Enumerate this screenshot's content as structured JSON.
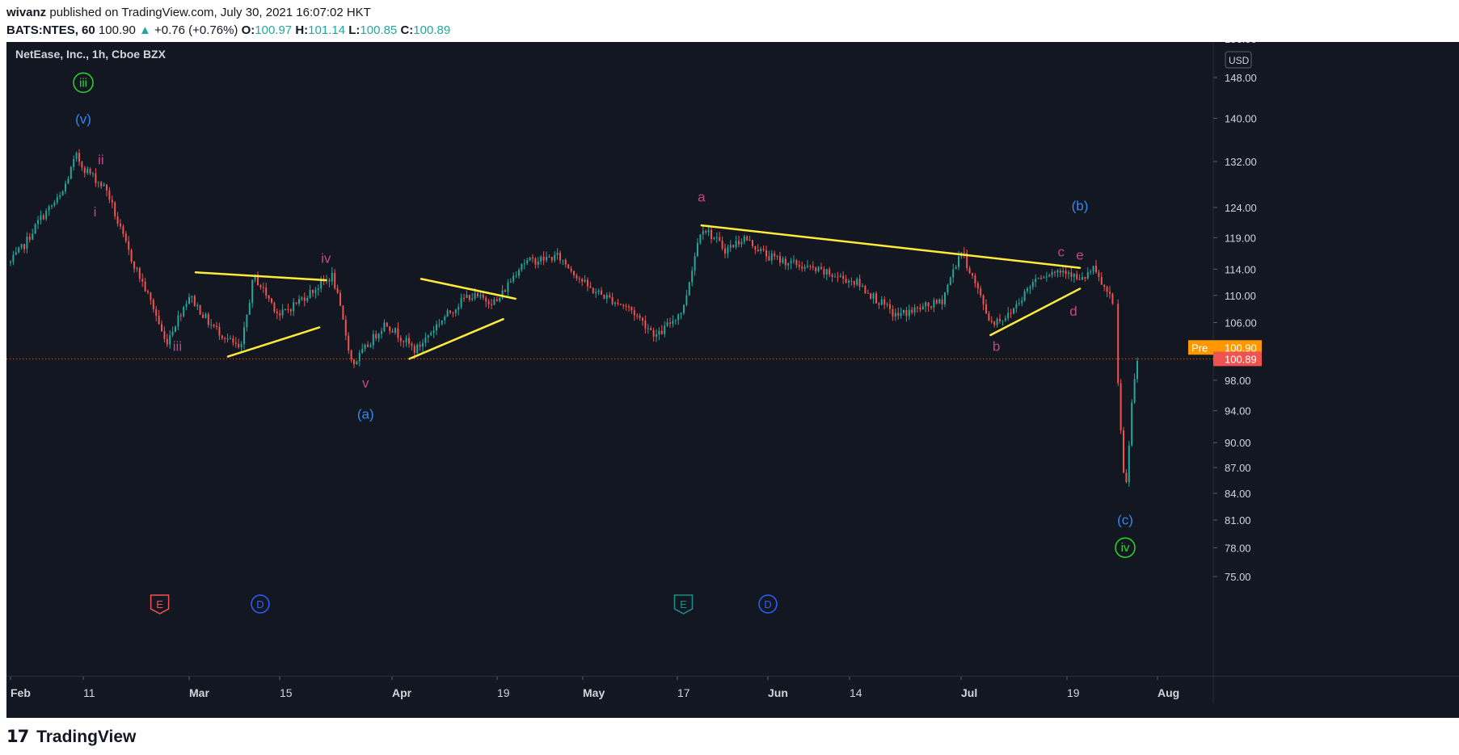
{
  "header": {
    "publisher": "wivanz",
    "published_text": "published on TradingView.com, July 30, 2021 16:07:02 HKT",
    "symbol": "BATS:NTES, 60",
    "last": "100.90",
    "arrow": "▲",
    "change": "+0.76 (+0.76%)",
    "o_label": "O:",
    "o": "100.97",
    "h_label": "H:",
    "h": "101.14",
    "l_label": "L:",
    "l": "100.85",
    "c_label": "C:",
    "c": "100.89"
  },
  "footer": {
    "logo_glyph": "𝟭𝟳",
    "brand": "TradingView"
  },
  "colors": {
    "background": "#131722",
    "grid": "#1e222d",
    "up": "#26a69a",
    "down": "#ef5350",
    "trendline": "#ffeb3b",
    "wave_magenta": "#c2478a",
    "wave_blue": "#2f89f5",
    "wave_green": "#2ad82a",
    "pre_badge": "#ff9800",
    "price_badge": "#ef5350"
  },
  "chart_data": {
    "type": "candlestick",
    "title": "NetEase, Inc., 1h, Cboe BZX",
    "currency": "USD",
    "x_ticks": [
      "Feb",
      "11",
      "Mar",
      "15",
      "Apr",
      "19",
      "May",
      "17",
      "Jun",
      "14",
      "Jul",
      "19",
      "Aug"
    ],
    "y_ticks": [
      "75.00",
      "78.00",
      "81.00",
      "84.00",
      "87.00",
      "90.00",
      "94.00",
      "98.00",
      "102.00",
      "106.00",
      "110.00",
      "114.00",
      "119.00",
      "124.00",
      "132.00",
      "140.00",
      "148.00",
      "156.00"
    ],
    "y_scale": "log",
    "ylim": [
      73,
      156
    ],
    "current_price": "100.89",
    "pre_label": "Pre",
    "pre_price": "100.90",
    "price_path": [
      [
        "2021-02-01",
        115
      ],
      [
        "2021-02-03",
        118
      ],
      [
        "2021-02-05",
        122
      ],
      [
        "2021-02-08",
        126
      ],
      [
        "2021-02-10",
        133
      ],
      [
        "2021-02-11",
        131
      ],
      [
        "2021-02-15",
        127
      ],
      [
        "2021-02-17",
        121
      ],
      [
        "2021-02-19",
        116
      ],
      [
        "2021-02-23",
        108
      ],
      [
        "2021-02-25",
        103
      ],
      [
        "2021-03-01",
        110
      ],
      [
        "2021-03-04",
        106
      ],
      [
        "2021-03-09",
        102
      ],
      [
        "2021-03-11",
        113
      ],
      [
        "2021-03-15",
        107
      ],
      [
        "2021-03-19",
        110
      ],
      [
        "2021-03-23",
        113
      ],
      [
        "2021-03-26",
        100
      ],
      [
        "2021-03-31",
        106
      ],
      [
        "2021-04-05",
        102
      ],
      [
        "2021-04-09",
        106
      ],
      [
        "2021-04-14",
        110
      ],
      [
        "2021-04-19",
        109
      ],
      [
        "2021-04-23",
        115
      ],
      [
        "2021-04-29",
        116
      ],
      [
        "2021-05-04",
        111
      ],
      [
        "2021-05-10",
        108
      ],
      [
        "2021-05-14",
        104
      ],
      [
        "2021-05-18",
        108
      ],
      [
        "2021-05-21",
        121
      ],
      [
        "2021-05-25",
        117
      ],
      [
        "2021-05-28",
        119
      ],
      [
        "2021-06-01",
        116
      ],
      [
        "2021-06-08",
        114
      ],
      [
        "2021-06-15",
        112
      ],
      [
        "2021-06-21",
        107
      ],
      [
        "2021-06-28",
        109
      ],
      [
        "2021-07-01",
        117
      ],
      [
        "2021-07-06",
        106
      ],
      [
        "2021-07-09",
        107
      ],
      [
        "2021-07-14",
        113
      ],
      [
        "2021-07-19",
        114
      ],
      [
        "2021-07-21",
        112
      ],
      [
        "2021-07-23",
        114
      ],
      [
        "2021-07-26",
        109
      ],
      [
        "2021-07-27",
        96
      ],
      [
        "2021-07-28",
        83
      ],
      [
        "2021-07-29",
        95
      ],
      [
        "2021-07-30",
        100.89
      ]
    ],
    "trendlines": [
      {
        "from": [
          "2021-03-02",
          113.5
        ],
        "to": [
          "2021-03-22",
          112.3
        ]
      },
      {
        "from": [
          "2021-03-07",
          101.2
        ],
        "to": [
          "2021-03-21",
          105.3
        ]
      },
      {
        "from": [
          "2021-04-06",
          112.5
        ],
        "to": [
          "2021-04-22",
          109.5
        ]
      },
      {
        "from": [
          "2021-04-04",
          100.9
        ],
        "to": [
          "2021-04-20",
          106.5
        ]
      },
      {
        "from": [
          "2021-05-21",
          121.0
        ],
        "to": [
          "2021-07-21",
          114.2
        ]
      },
      {
        "from": [
          "2021-07-06",
          104.2
        ],
        "to": [
          "2021-07-21",
          111.0
        ]
      }
    ],
    "wave_labels": [
      {
        "text": "iii",
        "date": "2021-02-11",
        "price": 146.0,
        "style": "green-circle"
      },
      {
        "text": "(v)",
        "date": "2021-02-11",
        "price": 139.0,
        "style": "blue"
      },
      {
        "text": "ii",
        "date": "2021-02-14",
        "price": 131.5,
        "style": "magenta"
      },
      {
        "text": "i",
        "date": "2021-02-13",
        "price": 122.5,
        "style": "magenta"
      },
      {
        "text": "iv",
        "date": "2021-03-22",
        "price": 115.0,
        "style": "magenta"
      },
      {
        "text": "iii",
        "date": "2021-02-27",
        "price": 102.0,
        "style": "magenta"
      },
      {
        "text": "v",
        "date": "2021-03-28",
        "price": 97.0,
        "style": "magenta"
      },
      {
        "text": "(a)",
        "date": "2021-03-28",
        "price": 93.0,
        "style": "blue"
      },
      {
        "text": "a",
        "date": "2021-05-21",
        "price": 125.0,
        "style": "magenta"
      },
      {
        "text": "b",
        "date": "2021-07-07",
        "price": 102.0,
        "style": "magenta"
      },
      {
        "text": "c",
        "date": "2021-07-18",
        "price": 116.0,
        "style": "magenta"
      },
      {
        "text": "e",
        "date": "2021-07-21",
        "price": 115.5,
        "style": "magenta"
      },
      {
        "text": "d",
        "date": "2021-07-20",
        "price": 107.0,
        "style": "magenta"
      },
      {
        "text": "(b)",
        "date": "2021-07-21",
        "price": 123.5,
        "style": "blue"
      },
      {
        "text": "(c)",
        "date": "2021-07-28",
        "price": 80.5,
        "style": "blue"
      },
      {
        "text": "iv",
        "date": "2021-07-28",
        "price": 77.5,
        "style": "green-circle"
      }
    ],
    "event_markers": [
      {
        "text": "E",
        "date": "2021-02-24",
        "style": "red"
      },
      {
        "text": "D",
        "date": "2021-03-12",
        "style": "blue"
      },
      {
        "text": "E",
        "date": "2021-05-18",
        "style": "teal"
      },
      {
        "text": "D",
        "date": "2021-06-01",
        "style": "blue"
      }
    ]
  }
}
